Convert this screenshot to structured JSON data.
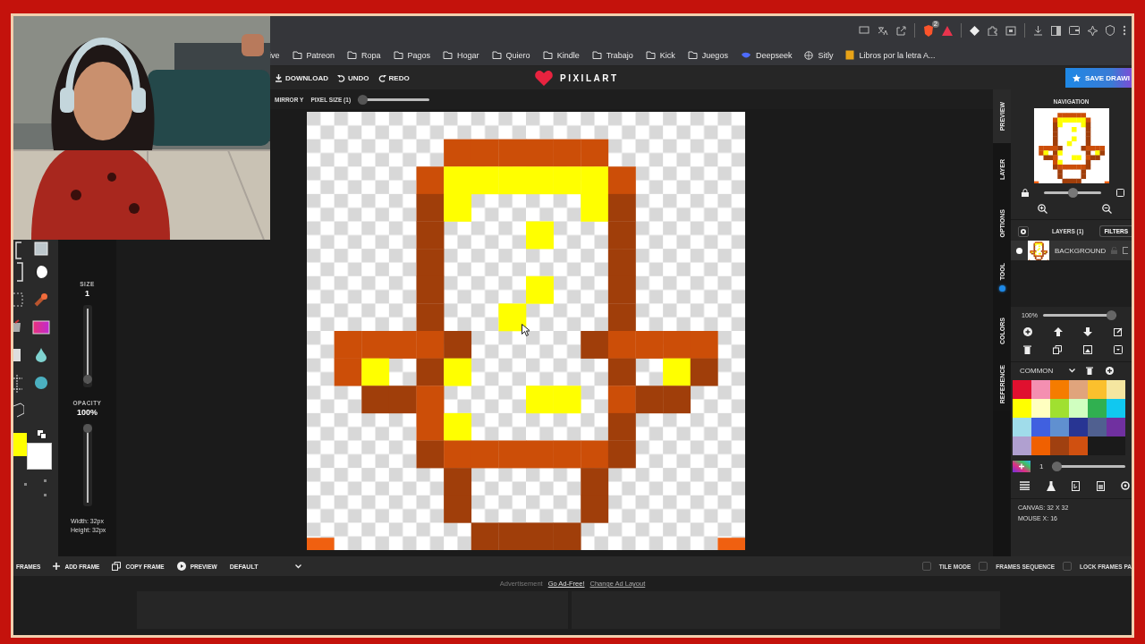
{
  "browser": {
    "extension_badge": "2",
    "bookmarks": [
      {
        "label": "ive",
        "kind": "text"
      },
      {
        "label": "Patreon",
        "kind": "folder"
      },
      {
        "label": "Ropa",
        "kind": "folder"
      },
      {
        "label": "Pagos",
        "kind": "folder"
      },
      {
        "label": "Hogar",
        "kind": "folder"
      },
      {
        "label": "Quiero",
        "kind": "folder"
      },
      {
        "label": "Kindle",
        "kind": "folder"
      },
      {
        "label": "Trabajo",
        "kind": "folder"
      },
      {
        "label": "Kick",
        "kind": "folder"
      },
      {
        "label": "Juegos",
        "kind": "folder"
      },
      {
        "label": "Deepseek",
        "kind": "whale"
      },
      {
        "label": "Sitly",
        "kind": "globe"
      },
      {
        "label": "Libros por la letra A...",
        "kind": "book"
      }
    ]
  },
  "header": {
    "actions": [
      {
        "label": "DOWNLOAD",
        "kind": "download"
      },
      {
        "label": "UNDO",
        "kind": "undo"
      },
      {
        "label": "REDO",
        "kind": "redo"
      }
    ],
    "logo": "PIXILART",
    "save_button": "SAVE DRAWI"
  },
  "options_bar": {
    "mirror": "MIRROR Y",
    "pixel_size": "PIXEL SIZE (1)",
    "pixel_slider": {
      "level": 0
    }
  },
  "tool_settings": {
    "size_label": "SIZE",
    "size_value": "1",
    "size_slider": {
      "level": 0.05
    },
    "opacity_label": "OPACITY",
    "opacity_value": "100%",
    "opacity_slider": {
      "level": 1
    },
    "width": "Width: 32px",
    "height": "Height: 32px"
  },
  "current_colors": [
    {
      "color": "#ffff00"
    },
    {
      "color": "#ffffff"
    }
  ],
  "side_tabs": [
    {
      "label": "PREVIEW",
      "selected": true,
      "dot": false
    },
    {
      "label": "LAYER",
      "selected": false,
      "dot": false
    },
    {
      "label": "OPTIONS",
      "selected": false,
      "dot": false
    },
    {
      "label": "TOOL",
      "selected": false,
      "dot": true
    },
    {
      "label": "COLORS",
      "selected": false,
      "dot": false
    },
    {
      "label": "REFERENCE",
      "selected": false,
      "dot": false
    }
  ],
  "navigation": {
    "title": "NAVIGATION",
    "zoom_slider": {
      "level": 0.5
    }
  },
  "layers": {
    "title": "LAYERS (1)",
    "filters": "FILTERS",
    "items": [
      {
        "name": "BACKGROUND",
        "visible": true,
        "selected": true
      }
    ],
    "opacity": "100%",
    "opacity_slider": {
      "level": 1
    }
  },
  "palette": {
    "name": "COMMON",
    "swatches": [
      {
        "color": "#e0102f"
      },
      {
        "color": "#f48fb1"
      },
      {
        "color": "#f57c00"
      },
      {
        "color": "#e0a47c"
      },
      {
        "color": "#fbc02d"
      },
      {
        "color": "#f5e6a0"
      },
      {
        "color": "#ffff00"
      },
      {
        "color": "#ffffc0"
      },
      {
        "color": "#a0e030"
      },
      {
        "color": "#d0ffc0"
      },
      {
        "color": "#30b050"
      },
      {
        "color": "#10c8f0"
      },
      {
        "color": "#a0dcea"
      },
      {
        "color": "#4060e0"
      },
      {
        "color": "#6090d0"
      },
      {
        "color": "#283593"
      },
      {
        "color": "#506090"
      },
      {
        "color": "#7030a0"
      },
      {
        "color": "#b0a0d0"
      },
      {
        "color": "#f06000"
      },
      {
        "color": "#a04010"
      },
      {
        "color": "#d05010"
      },
      {
        "color": "#1a1a1a"
      },
      {
        "color": "#1a1a1a"
      }
    ],
    "brush_value": "1",
    "brush_slider": {
      "level": 0
    }
  },
  "status": [
    "CANVAS: 32 X 32",
    "MOUSE X: 16"
  ],
  "frames_bar": {
    "label": "FRAMES",
    "actions": [
      {
        "label": "ADD FRAME",
        "kind": "add"
      },
      {
        "label": "COPY FRAME",
        "kind": "copy"
      },
      {
        "label": "PREVIEW",
        "kind": "play"
      }
    ],
    "dropdown": "DEFAULT",
    "toggles": [
      {
        "label": "TILE MODE",
        "checked": false
      },
      {
        "label": "FRAMES SEQUENCE",
        "checked": false
      },
      {
        "label": "LOCK FRAMES PA",
        "checked": false
      }
    ]
  },
  "ad_bar": {
    "label": "Advertisement",
    "go_ad_free": "Go Ad-Free!",
    "change_layout": "Change Ad Layout"
  }
}
